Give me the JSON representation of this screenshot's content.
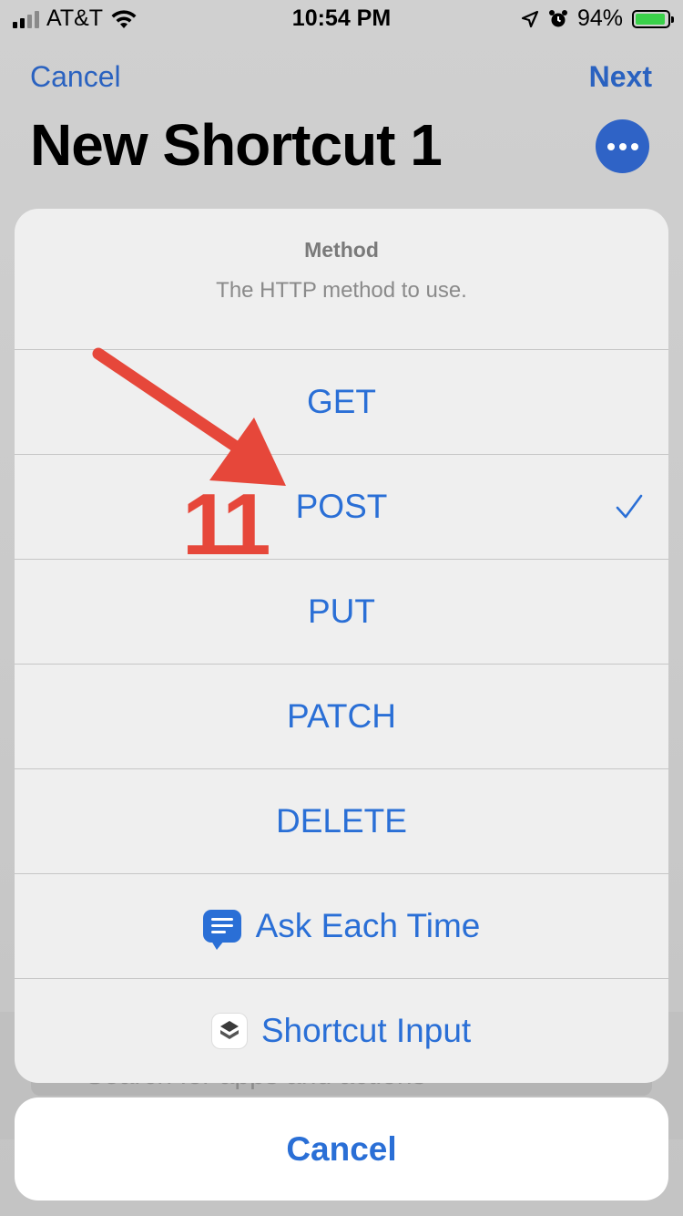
{
  "status_bar": {
    "carrier": "AT&T",
    "time": "10:54 PM",
    "battery": "94%",
    "battery_level": 0.94
  },
  "nav": {
    "cancel_label": "Cancel",
    "next_label": "Next",
    "title": "New Shortcut 1"
  },
  "search": {
    "placeholder": "Search for apps and actions"
  },
  "sheet": {
    "title": "Method",
    "subtitle": "The HTTP method to use.",
    "options": [
      {
        "label": "GET"
      },
      {
        "label": "POST",
        "selected": true
      },
      {
        "label": "PUT"
      },
      {
        "label": "PATCH"
      },
      {
        "label": "DELETE"
      },
      {
        "label": "Ask Each Time",
        "icon": "chat-bubble-icon"
      },
      {
        "label": "Shortcut Input",
        "icon": "shortcuts-icon"
      }
    ],
    "cancel_label": "Cancel"
  },
  "annotation": {
    "number": "11",
    "color": "#e6473a"
  },
  "colors": {
    "accent": "#2a6fd6",
    "nav_blue": "#2a62c0"
  }
}
